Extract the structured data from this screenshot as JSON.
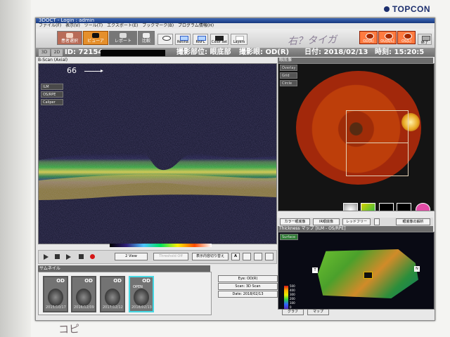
{
  "brand": "TOPCON",
  "window": {
    "title": "3DOCT - Login : admin",
    "menu": [
      "ファイル(F)",
      "表示(V)",
      "ツール(T)",
      "エクスポート(E)",
      "ブックマーク(B)",
      "プログラム情報(H)"
    ]
  },
  "toolbar": {
    "patient_select": "患者選択",
    "viewer": "ビューア",
    "report": "レポート",
    "compare": "比較",
    "retina": "Retina",
    "rnfl": "RNFL",
    "color_set": "Color set",
    "layers": "Layers",
    "handwritten_note": "右？タイガ",
    "eye_buttons": [
      "OD(R)",
      "OU(R/L)",
      "OS(L)"
    ],
    "exit": "終了"
  },
  "info": {
    "tab_3d": "3D",
    "tab_2d": "2D",
    "id": "ID: 72154",
    "area_label": "撮影部位: 眼底部",
    "eye_label": "撮影眼: OD(R)",
    "date_label": "日付: 2018/02/13",
    "time_label": "時刻: 15:20:5"
  },
  "bscan": {
    "title": "B-Scan (Axial)",
    "buttons": [
      "ILM",
      "OS/RPE",
      "Caliper"
    ],
    "slice_number": "66"
  },
  "controls": {
    "view": "2 View",
    "threshold": "Threshold Off",
    "display_toggle": "表示内容切り替え",
    "a_label": "A"
  },
  "thumbnails": {
    "title": "サムネイル",
    "items": [
      {
        "eye": "OD",
        "date": "2015/10/17"
      },
      {
        "eye": "OD",
        "date": "2016/12/09"
      },
      {
        "eye": "OD",
        "date": "2017/12/12"
      },
      {
        "eye": "OD",
        "date": "2018/02/13"
      }
    ],
    "selected_label": "OPEN"
  },
  "scan_info": {
    "eye": "Eye: OD(R)",
    "scan": "Scan: 3D Scan",
    "date": "Date: 2018/02/13"
  },
  "fundus": {
    "title": "眼底像",
    "buttons": [
      "Overlay",
      "Grid",
      "Circle"
    ],
    "tools": [
      "カラー眼底像",
      "IR眼底像",
      "レッドフリー",
      "眼底像の解析"
    ]
  },
  "thickness": {
    "title": "Thickness マップ [ILM - OS/RPE]",
    "button": "Surface",
    "scale": [
      "500",
      "400",
      "300",
      "200",
      "100",
      "0"
    ],
    "tabs": [
      "グラフ",
      "マップ"
    ],
    "t_label": "T",
    "n_label": "N"
  },
  "paper_note": "コピ"
}
